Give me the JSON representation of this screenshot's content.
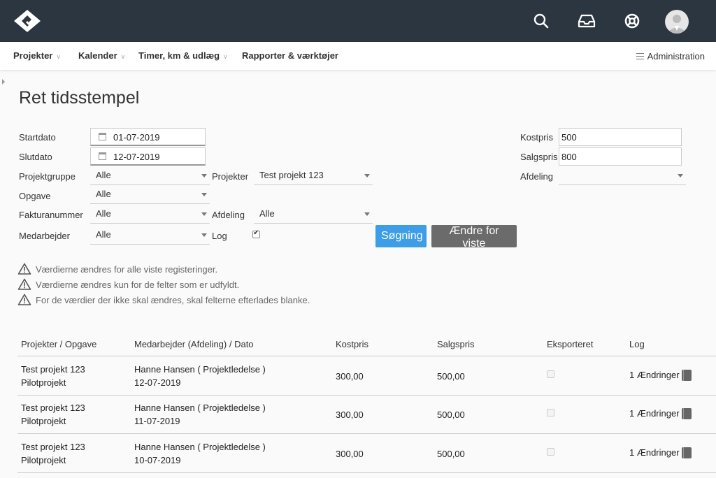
{
  "nav": {
    "items": [
      "Projekter",
      "Kalender",
      "Timer, km & udlæg",
      "Rapporter & værktøjer"
    ],
    "admin": "Administration"
  },
  "page": {
    "title": "Ret tidsstempel"
  },
  "form": {
    "startdato_label": "Startdato",
    "startdato_value": "01-07-2019",
    "slutdato_label": "Slutdato",
    "slutdato_value": "12-07-2019",
    "projektgruppe_label": "Projektgruppe",
    "projektgruppe_value": "Alle",
    "projekter_label": "Projekter",
    "projekter_value": "Test projekt 123",
    "opgave_label": "Opgave",
    "opgave_value": "Alle",
    "fakturanummer_label": "Fakturanummer",
    "fakturanummer_value": "Alle",
    "afdeling_label": "Afdeling",
    "afdeling_value": "Alle",
    "medarbejder_label": "Medarbejder",
    "medarbejder_value": "Alle",
    "log_label": "Log",
    "kostpris_label": "Kostpris",
    "kostpris_value": "500",
    "salgspris_label": "Salgspris",
    "salgspris_value": "800",
    "afdeling2_label": "Afdeling",
    "afdeling2_value": "",
    "search_button": "Søgning",
    "change_button": "Ændre for viste"
  },
  "notices": [
    "Værdierne ændres for alle viste registeringer.",
    "Værdierne ændres kun for de felter som er udfyldt.",
    "For de værdier der ikke skal ændres, skal felterne efterlades blanke."
  ],
  "table": {
    "headers": [
      "Projekter / Opgave",
      "Medarbejder (Afdeling) / Dato",
      "Kostpris",
      "Salgspris",
      "Eksporteret",
      "Log"
    ],
    "rows": [
      {
        "project": "Test projekt 123",
        "task": "Pilotprojekt",
        "employee": "Hanne Hansen ( Projektledelse )",
        "date": "12-07-2019",
        "kostpris": "300,00",
        "salgspris": "500,00",
        "log": "1 Ændringer"
      },
      {
        "project": "Test projekt 123",
        "task": "Pilotprojekt",
        "employee": "Hanne Hansen ( Projektledelse )",
        "date": "11-07-2019",
        "kostpris": "300,00",
        "salgspris": "500,00",
        "log": "1 Ændringer"
      },
      {
        "project": "Test projekt 123",
        "task": "Pilotprojekt",
        "employee": "Hanne Hansen ( Projektledelse )",
        "date": "10-07-2019",
        "kostpris": "300,00",
        "salgspris": "500,00",
        "log": "1 Ændringer"
      }
    ]
  },
  "icons": {
    "logo": "logo-icon",
    "search": "search-icon",
    "inbox": "inbox-icon",
    "help": "lifebuoy-icon",
    "avatar": "avatar-icon",
    "calendar": "calendar-icon",
    "warning": "warning-icon",
    "log": "log-book-icon"
  },
  "colors": {
    "topbar": "#2b3640",
    "primary": "#3d9de6",
    "secondary": "#6b6b6b"
  }
}
